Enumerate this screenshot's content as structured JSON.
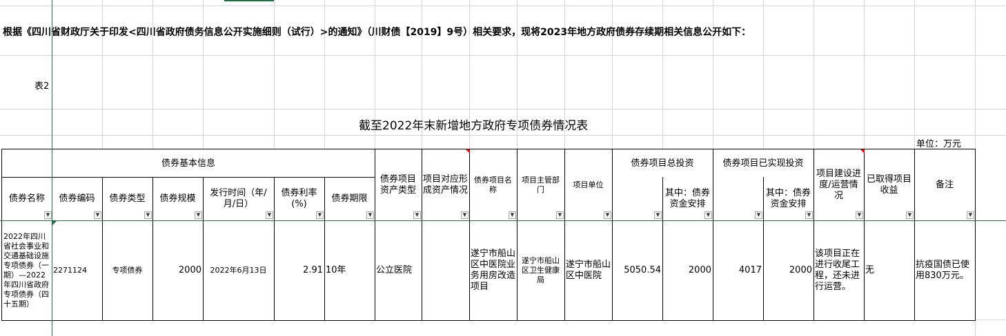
{
  "document": {
    "intro": "根据《四川省财政厅关于印发<四川省政府债务信息公开实施细则（试行）>的通知》（川财债【2019】9号）相关要求，现将2023年地方政府债券存续期相关信息公开如下：",
    "table_no": "表2",
    "title": "截至2022年末新增地方政府专项债券情况表",
    "unit": "单位：万元"
  },
  "table": {
    "groups": {
      "basic": "债券基本信息",
      "total_invest": "债券项目总投资",
      "realized_invest": "债券项目已实现投资"
    },
    "headers": {
      "name": "债券名称",
      "code": "债券编码",
      "type": "债券类型",
      "scale": "债券规模",
      "issue_date": "发行时间（年/月/日）",
      "rate": "债券利率(%)",
      "term": "债券期限",
      "asset_type": "债券项目资产类型",
      "asset_formed": "项目对应形成资产情况",
      "project_name": "债券项目名称",
      "authority": "项目主管部门",
      "unit": "项目单位",
      "total_bond_part": "其中：债券资金安排",
      "realized_bond_part": "其中：债券资金安排",
      "progress": "项目建设进度/运营情况",
      "income": "已取得项目收益",
      "remark": "备注"
    },
    "row": {
      "name": "2022年四川省社会事业和交通基础设施专项债券（一期）—2022年四川省政府专项债券（四十五期）",
      "code": "2271124",
      "type": "专项债券",
      "scale": "2000",
      "issue_date": "2022年6月13日",
      "rate": "2.91",
      "term": "10年",
      "asset_type": "公立医院",
      "asset_formed": "",
      "project_name": "遂宁市船山区中医院业务用房改造项目",
      "authority": "遂宁市船山区卫生健康局",
      "unit": "遂宁市船山区中医院",
      "total_invest": "5050.54",
      "total_bond_part": "2000",
      "realized_invest": "4017",
      "realized_bond_part": "2000",
      "progress": "该项目正在进行收尾工程，还未进行运营。",
      "income": "无",
      "remark": "抗疫国债已使用830万元。"
    }
  }
}
